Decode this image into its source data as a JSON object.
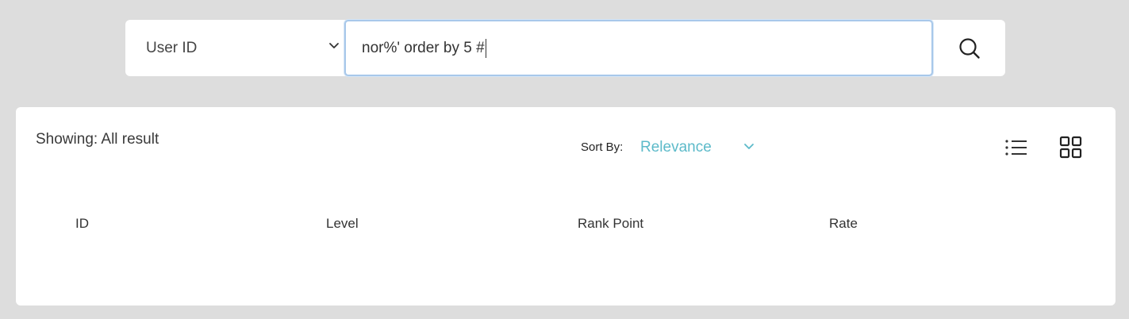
{
  "search": {
    "type_selected": "User ID",
    "query_value": "nor%' order by 5 #"
  },
  "results": {
    "showing_label": "Showing: All result",
    "sort_label": "Sort By:",
    "sort_value": "Relevance",
    "columns": [
      "ID",
      "Level",
      "Rank Point",
      "Rate"
    ]
  },
  "colors": {
    "page_bg": "#dddddd",
    "panel_bg": "#ffffff",
    "accent": "#5cbac9",
    "focus_border": "#a8c8ea"
  },
  "icons": {
    "search": "search-icon",
    "type_dropdown": "chevron-down-icon",
    "sort_dropdown": "chevron-down-icon",
    "list_view": "list-view-icon",
    "grid_view": "grid-view-icon"
  }
}
